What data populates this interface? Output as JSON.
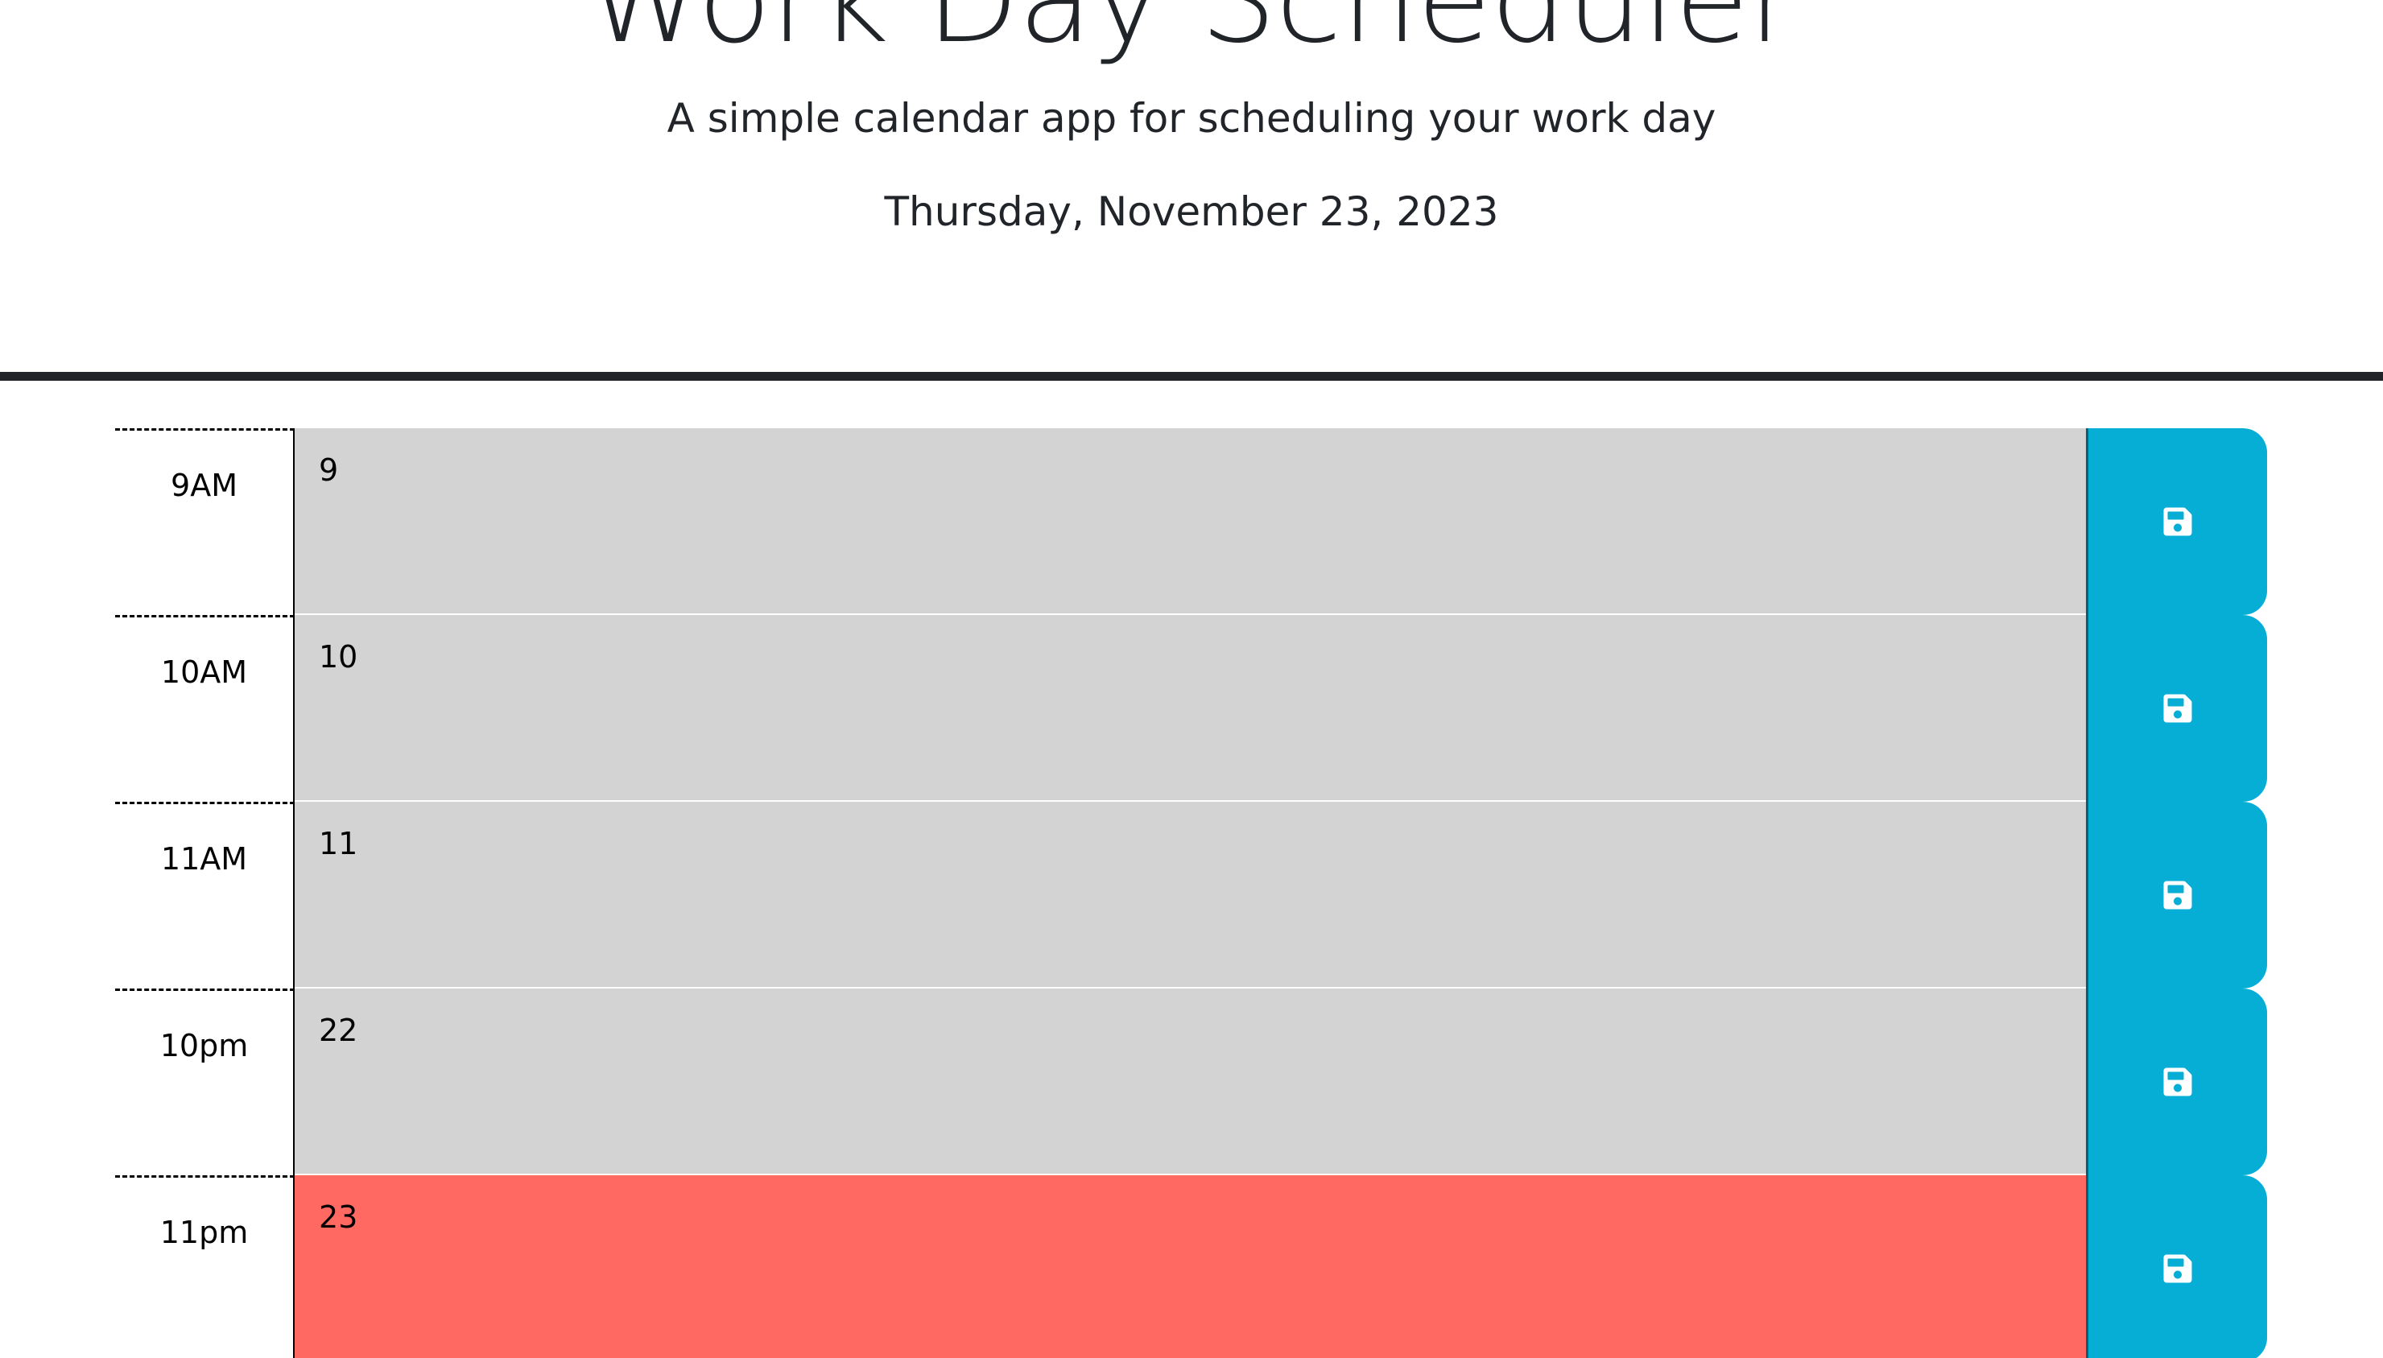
{
  "header": {
    "title": "Work Day Scheduler",
    "subtitle": "A simple calendar app for scheduling your work day",
    "current_day": "Thursday, November 23, 2023"
  },
  "colors": {
    "past": "#d3d3d3",
    "present": "#ff6961",
    "future": "#77dd77",
    "save_button": "#06aed5",
    "header_rule": "#212529"
  },
  "time_blocks": [
    {
      "hour_label": "9AM",
      "text": "9",
      "status": "past",
      "save_icon": "floppy-disk-icon"
    },
    {
      "hour_label": "10AM",
      "text": "10",
      "status": "past",
      "save_icon": "floppy-disk-icon"
    },
    {
      "hour_label": "11AM",
      "text": "11",
      "status": "past",
      "save_icon": "floppy-disk-icon"
    },
    {
      "hour_label": "10pm",
      "text": "22",
      "status": "past",
      "save_icon": "floppy-disk-icon"
    },
    {
      "hour_label": "11pm",
      "text": "23",
      "status": "present",
      "save_icon": "floppy-disk-icon"
    }
  ]
}
